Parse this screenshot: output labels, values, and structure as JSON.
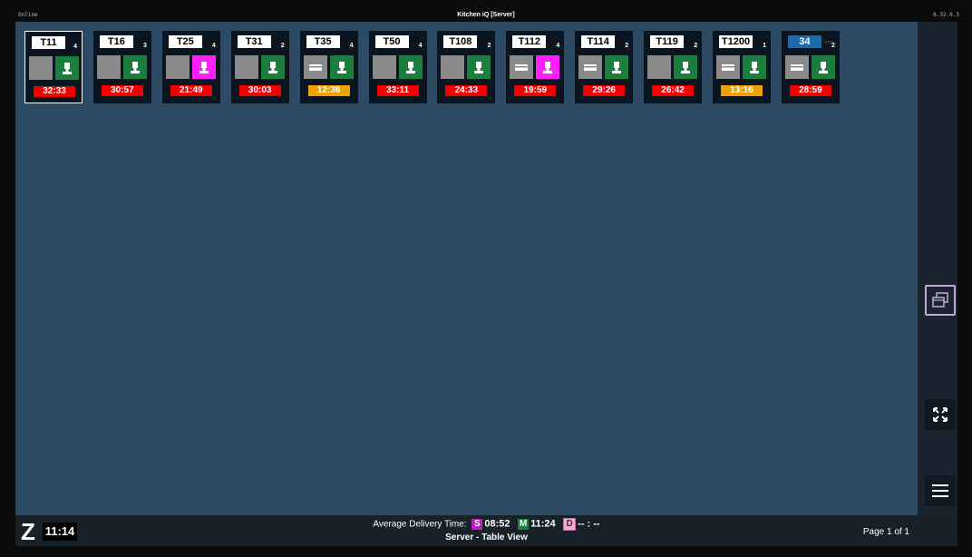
{
  "window": {
    "status": "Online",
    "title": "Kitchen iQ [Server]",
    "version": "6.32.0.3"
  },
  "tables": [
    {
      "name": "T11",
      "guests": "4",
      "left": "gray",
      "right": "green",
      "left_icon": "",
      "right_icon": "chef-icon",
      "timer": "32:33",
      "timer_color": "red",
      "selected": true
    },
    {
      "name": "T16",
      "guests": "3",
      "left": "gray",
      "right": "green",
      "left_icon": "",
      "right_icon": "chef-icon",
      "timer": "30:57",
      "timer_color": "red"
    },
    {
      "name": "T25",
      "guests": "4",
      "left": "gray",
      "right": "magenta",
      "left_icon": "",
      "right_icon": "chef-icon",
      "timer": "21:49",
      "timer_color": "red"
    },
    {
      "name": "T31",
      "guests": "2",
      "left": "gray",
      "right": "green",
      "left_icon": "",
      "right_icon": "chef-icon",
      "timer": "30:03",
      "timer_color": "red"
    },
    {
      "name": "T35",
      "guests": "4",
      "left": "gray",
      "right": "green",
      "left_icon": "tray-icon",
      "right_icon": "chef-icon",
      "timer": "12:36",
      "timer_color": "orange"
    },
    {
      "name": "T50",
      "guests": "4",
      "left": "gray",
      "right": "green",
      "left_icon": "",
      "right_icon": "chef-icon",
      "timer": "33:11",
      "timer_color": "red"
    },
    {
      "name": "T108",
      "guests": "2",
      "left": "gray",
      "right": "green",
      "left_icon": "",
      "right_icon": "chef-icon",
      "timer": "24:33",
      "timer_color": "red"
    },
    {
      "name": "T112",
      "guests": "4",
      "left": "gray",
      "right": "magenta",
      "left_icon": "tray-icon",
      "right_icon": "chef-icon",
      "timer": "19:59",
      "timer_color": "red"
    },
    {
      "name": "T114",
      "guests": "2",
      "left": "gray",
      "right": "green",
      "left_icon": "tray-icon",
      "right_icon": "chef-icon",
      "timer": "29:26",
      "timer_color": "red"
    },
    {
      "name": "T119",
      "guests": "2",
      "left": "gray",
      "right": "green",
      "left_icon": "",
      "right_icon": "chef-icon",
      "timer": "26:42",
      "timer_color": "red"
    },
    {
      "name": "T1200",
      "guests": "1",
      "left": "gray",
      "right": "green",
      "left_icon": "tray-icon",
      "right_icon": "chef-icon",
      "timer": "13:16",
      "timer_color": "orange"
    },
    {
      "name": "34",
      "guests": "2",
      "left": "gray",
      "right": "green",
      "left_icon": "tray-icon",
      "right_icon": "chef-icon",
      "timer": "28:59",
      "timer_color": "red",
      "blue": true,
      "wifi": true
    }
  ],
  "sidebar": {
    "buttons": [
      "cards-view-icon",
      "fullscreen-icon",
      "menu-icon"
    ]
  },
  "footer": {
    "logo": "Z",
    "clock": "11:14",
    "avg_label": "Average Delivery Time:",
    "s_badge": "S",
    "s_time": "08:52",
    "m_badge": "M",
    "m_time": "11:24",
    "d_badge": "D",
    "d_time": "-- : --",
    "view_label": "Server - Table View",
    "page": "Page 1 of 1"
  },
  "colors": {
    "background": "#2c4a64",
    "green": "#1a7f3c",
    "magenta": "#ff1fff",
    "red": "#f20000",
    "orange": "#f0a000"
  }
}
